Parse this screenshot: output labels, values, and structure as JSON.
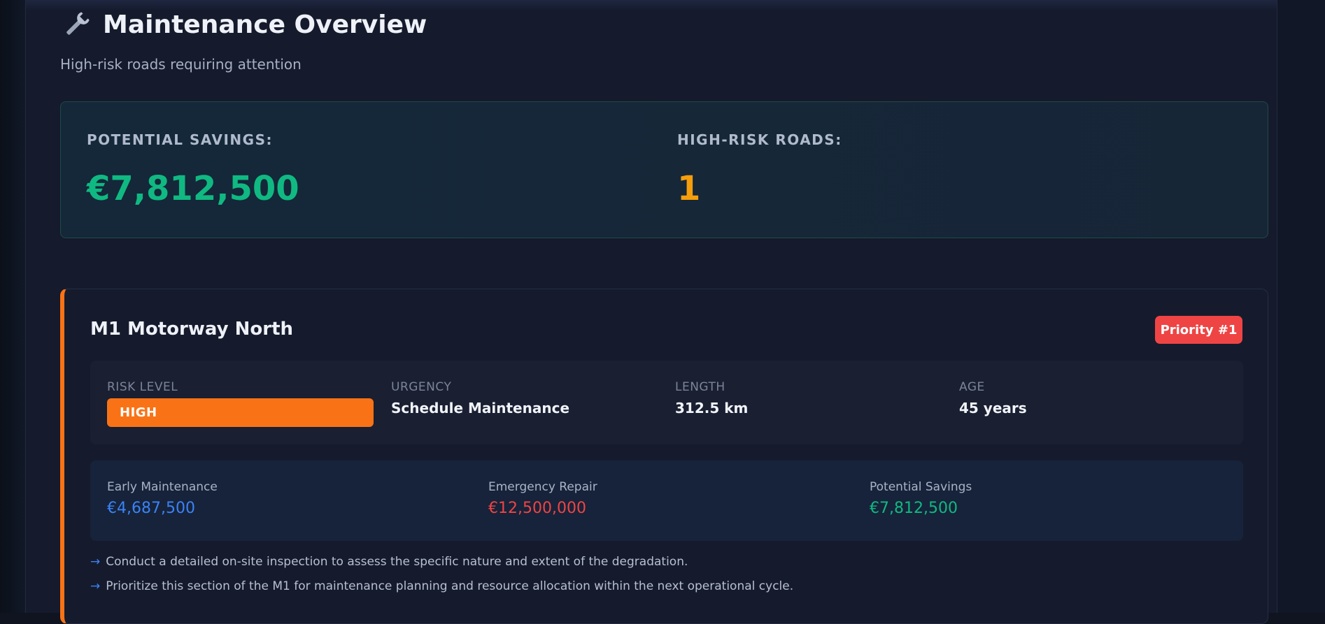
{
  "header": {
    "icon": "wrench-icon",
    "title": "Maintenance Overview",
    "subtitle": "High-risk roads requiring attention"
  },
  "summary": {
    "savings_label": "POTENTIAL SAVINGS:",
    "savings_value": "€7,812,500",
    "savings_color": "#10b981",
    "roads_label": "HIGH-RISK ROADS:",
    "roads_value": "1",
    "roads_color": "#f59e0b"
  },
  "road": {
    "name": "M1 Motorway North",
    "priority": "Priority #1",
    "accent_color": "#f97316",
    "stats": {
      "risk_label": "RISK LEVEL",
      "risk_value": "HIGH",
      "urgency_label": "URGENCY",
      "urgency_value": "Schedule Maintenance",
      "length_label": "LENGTH",
      "length_value": "312.5 km",
      "age_label": "AGE",
      "age_value": "45 years"
    },
    "costs": {
      "early_label": "Early Maintenance",
      "early_value": "€4,687,500",
      "early_color": "#3b82f6",
      "emergency_label": "Emergency Repair",
      "emergency_value": "€12,500,000",
      "emergency_color": "#ef4444",
      "savings_label": "Potential Savings",
      "savings_value": "€7,812,500",
      "savings_color": "#10b981"
    },
    "recommendations": [
      "Conduct a detailed on-site inspection to assess the specific nature and extent of the degradation.",
      "Prioritize this section of the M1 for maintenance planning and resource allocation within the next operational cycle."
    ],
    "arrow_glyph": "→"
  }
}
